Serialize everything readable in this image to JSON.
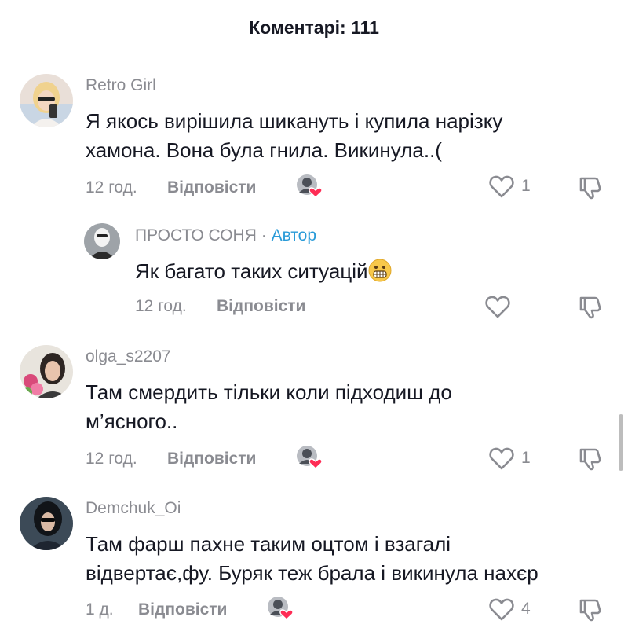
{
  "header": {
    "title": "Коментарі: 111"
  },
  "comments": [
    {
      "username": "Retro Girl",
      "text_lines": [
        "Я якось вирішила шикануть і купила нарізку",
        "хамона. Вона була гнила. Викинула..("
      ],
      "time": "12 год.",
      "reply_label": "Відповісти",
      "like_count": "1"
    },
    {
      "username": "ПРОСТО СОНЯ",
      "author_tag": "Автор",
      "separator": "·",
      "text": "Як багато таких ситуацій",
      "emoji": "grimacing-face",
      "time": "12 год.",
      "reply_label": "Відповісти",
      "like_count": ""
    },
    {
      "username": "olga_s2207",
      "text_lines": [
        "Там смердить тільки коли підходиш до",
        "м’ясного.."
      ],
      "time": "12 год.",
      "reply_label": "Відповісти",
      "like_count": "1"
    },
    {
      "username": "Demchuk_Oi",
      "text_lines": [
        "Там фарш пахне таким оцтом і взагалі",
        "відвертає,фу. Буряк теж брала і викинула нахєр"
      ],
      "time": "1 д.",
      "reply_label": "Відповісти",
      "like_count": "4"
    }
  ],
  "icons": {
    "like": "heart-outline-icon",
    "dislike": "thumb-down-icon",
    "liked_by_creator": "creator-liked-badge"
  },
  "colors": {
    "text": "#161823",
    "muted": "#8a8b91",
    "author": "#2a9bd8",
    "heart": "#fe2c55"
  }
}
